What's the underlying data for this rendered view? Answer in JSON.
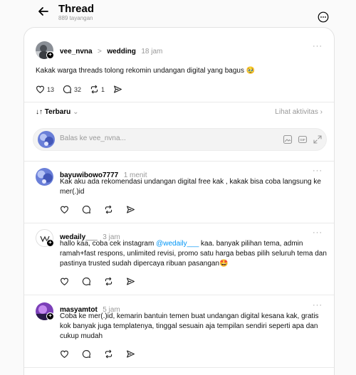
{
  "header": {
    "title": "Thread",
    "views": "889 tayangan",
    "back_icon": "arrow-left-icon",
    "more_icon": "more-circle-icon"
  },
  "post": {
    "username": "vee_nvna",
    "separator": ">",
    "topic": "wedding",
    "time": "18 jam",
    "text": "Kakak warga threads tolong rekomin undangan digital yang bagus 🥹",
    "likes": "13",
    "comments": "32",
    "reposts": "1"
  },
  "sort": {
    "label": "Terbaru",
    "activity": "Lihat aktivitas"
  },
  "reply_box": {
    "placeholder": "Balas ke vee_nvna..."
  },
  "replies": [
    {
      "username": "bayuwibowo7777",
      "time": "1 menit",
      "text": "Kak aku ada rekomendasi undangan digital free kak , kakak bisa coba langsung ke mer(.)id"
    },
    {
      "username": "wedaily___",
      "time": "3 jam",
      "text_before": "hallo kaa, coba cek instagram ",
      "mention": "@wedaily___",
      "text_after": " kaa. banyak pilihan tema, admin ramah+fast respons, unlimited revisi, promo satu harga bebas pilih seluruh tema dan pastinya trusted sudah dipercaya ribuan pasangan🤩"
    },
    {
      "username": "masyamtot",
      "time": "5 jam",
      "text": "Coba ke mer(.)id, kemarin bantuin temen buat undangan digital kesana kak, gratis kok banyak juga templatenya, tinggal sesuain aja tempilan sendiri seperti apa dan cukup mudah"
    }
  ],
  "colors": {
    "link": "#0095f6",
    "muted": "#999999",
    "background": "#fafafa"
  }
}
